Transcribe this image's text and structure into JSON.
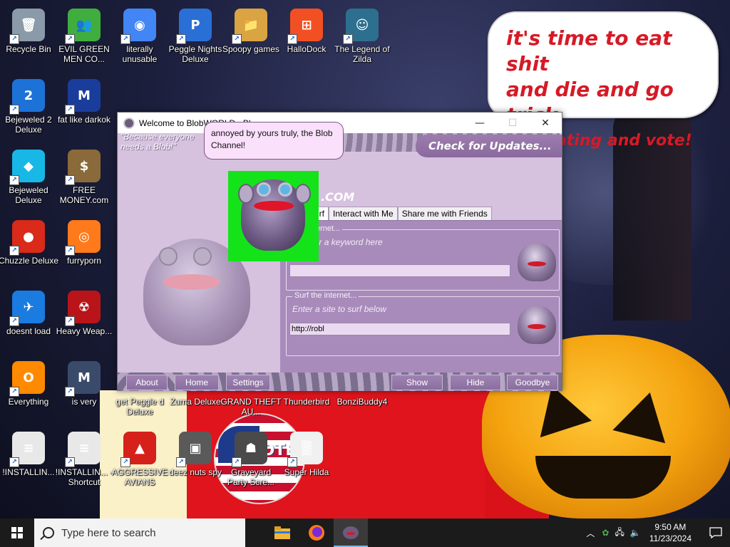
{
  "desktop": {
    "icons": [
      {
        "label": "Recycle Bin",
        "glyph": "🗑",
        "color": "#8a9aa8"
      },
      {
        "label": "EVIL GREEN MEN CO...",
        "glyph": "👥",
        "color": "#3fae3f"
      },
      {
        "label": "literally unusable",
        "glyph": "◉",
        "color": "#4285f4"
      },
      {
        "label": "Peggle Nights Deluxe",
        "glyph": "P",
        "color": "#2a6fd6"
      },
      {
        "label": "Spoopy games",
        "glyph": "📁",
        "color": "#d9a441"
      },
      {
        "label": "HalloDock",
        "glyph": "⊞",
        "color": "#f25022"
      },
      {
        "label": "The Legend of Zilda",
        "glyph": "☺",
        "color": "#2d6f8f"
      },
      {
        "label": "Bejeweled 2 Deluxe",
        "glyph": "2",
        "color": "#1d72d8"
      },
      {
        "label": "fat like darkok",
        "glyph": "M",
        "color": "#1a3d9c"
      },
      {
        "label": "Bejeweled Deluxe",
        "glyph": "◆",
        "color": "#18b8e6"
      },
      {
        "label": "FREE MONEY.com",
        "glyph": "$",
        "color": "#8a6a3a"
      },
      {
        "label": "Chuzzle Deluxe",
        "glyph": "●",
        "color": "#d92a1a"
      },
      {
        "label": "furryporn",
        "glyph": "◎",
        "color": "#ff7a1a"
      },
      {
        "label": "doesnt load",
        "glyph": "✈",
        "color": "#1a7be0"
      },
      {
        "label": "Heavy Weap...",
        "glyph": "☢",
        "color": "#b8141a"
      },
      {
        "label": "Everything",
        "glyph": "O",
        "color": "#ff8a00"
      },
      {
        "label": "is very",
        "glyph": "M",
        "color": "#3a4a6a"
      },
      {
        "label": "!INSTALLIN...",
        "glyph": "≡",
        "color": "#e8e8e8"
      },
      {
        "label": "!INSTALLIN... - Shortcut",
        "glyph": "≡",
        "color": "#e8e8e8"
      },
      {
        "label": "AGGRESSIVE AVIANS",
        "glyph": "▲",
        "color": "#d6201a"
      },
      {
        "label": "deez nuts spy",
        "glyph": "▣",
        "color": "#5a5a5a"
      },
      {
        "label": "Graveyard Party Scre...",
        "glyph": "☗",
        "color": "#4a4a4a"
      },
      {
        "label": "Super Hilda",
        "glyph": "▒",
        "color": "#f0f0f0"
      },
      {
        "label": "get Peggle d Deluxe",
        "glyph": "",
        "color": ""
      },
      {
        "label": "Zuma Deluxe",
        "glyph": "",
        "color": ""
      },
      {
        "label": "GRAND THEFT AU...",
        "glyph": "",
        "color": ""
      },
      {
        "label": "Thunderbird",
        "glyph": "",
        "color": ""
      },
      {
        "label": "BonziBuddy4",
        "glyph": "",
        "color": ""
      }
    ]
  },
  "bubble": {
    "line1": "it's time to eat shit",
    "line2": "and die and go trick",
    "line3": "or treating and vote!"
  },
  "flag_text": "VOTE!",
  "window": {
    "title": "Welcome to BlobWORLD - Bl...",
    "minimize": "—",
    "maximize": "☐",
    "close": "✕",
    "tagline_1": "\"Because everyone",
    "tagline_2": "needs a Blob!\"",
    "check_updates": "Check for Updates...",
    "brand": ".COM",
    "tabs": [
      "urf",
      "Interact with Me",
      "Share me with Friends"
    ],
    "search_group_title": "the internet...",
    "search_hint": "or enter a keyword here",
    "search_value": "",
    "surf_group_title": "Surf the internet...",
    "surf_hint": "Enter a site to surf below",
    "surf_value": "http://robl",
    "buttons": [
      "About",
      "Home",
      "Settings",
      "Show",
      "Hide",
      "Goodbye"
    ]
  },
  "tooltip": {
    "text": "annoyed by yours truly, the Blob Channel!"
  },
  "taskbar": {
    "search_placeholder": "Type here to search",
    "time": "9:50 AM",
    "date": "11/23/2024"
  },
  "colors": {
    "window_bg": "#d6c1df",
    "panel": "#a88bbb",
    "green_bg": "#14e31a",
    "bubble_text": "#d61a26",
    "taskbar": "#1b1b1b"
  }
}
